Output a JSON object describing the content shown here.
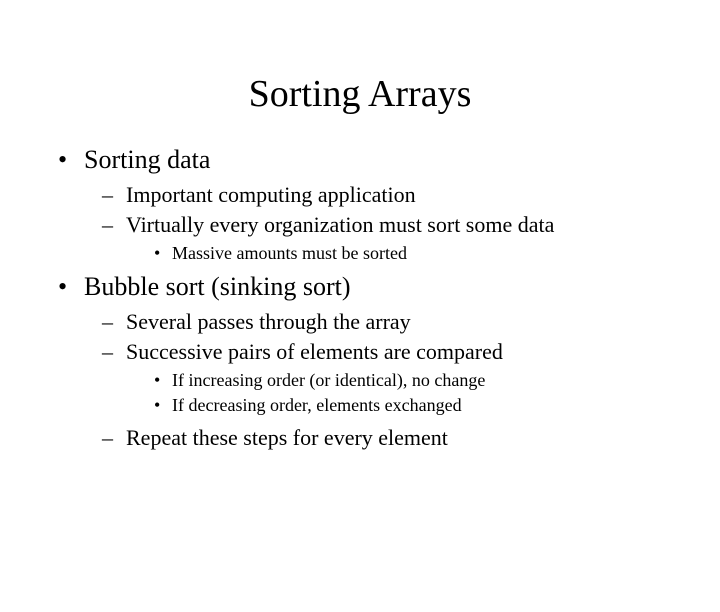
{
  "title": "Sorting Arrays",
  "bullets": [
    {
      "text": "Sorting data",
      "sub": [
        {
          "text": "Important computing application"
        },
        {
          "text": "Virtually every organization must sort some data",
          "sub": [
            {
              "text": "Massive amounts must be sorted"
            }
          ]
        }
      ]
    },
    {
      "text": "Bubble sort (sinking sort)",
      "sub": [
        {
          "text": "Several passes through the array"
        },
        {
          "text": "Successive pairs of elements are compared",
          "sub": [
            {
              "text": "If increasing order (or identical), no change"
            },
            {
              "text": "If decreasing order, elements exchanged"
            }
          ]
        },
        {
          "text": "Repeat these steps for every element"
        }
      ]
    }
  ]
}
